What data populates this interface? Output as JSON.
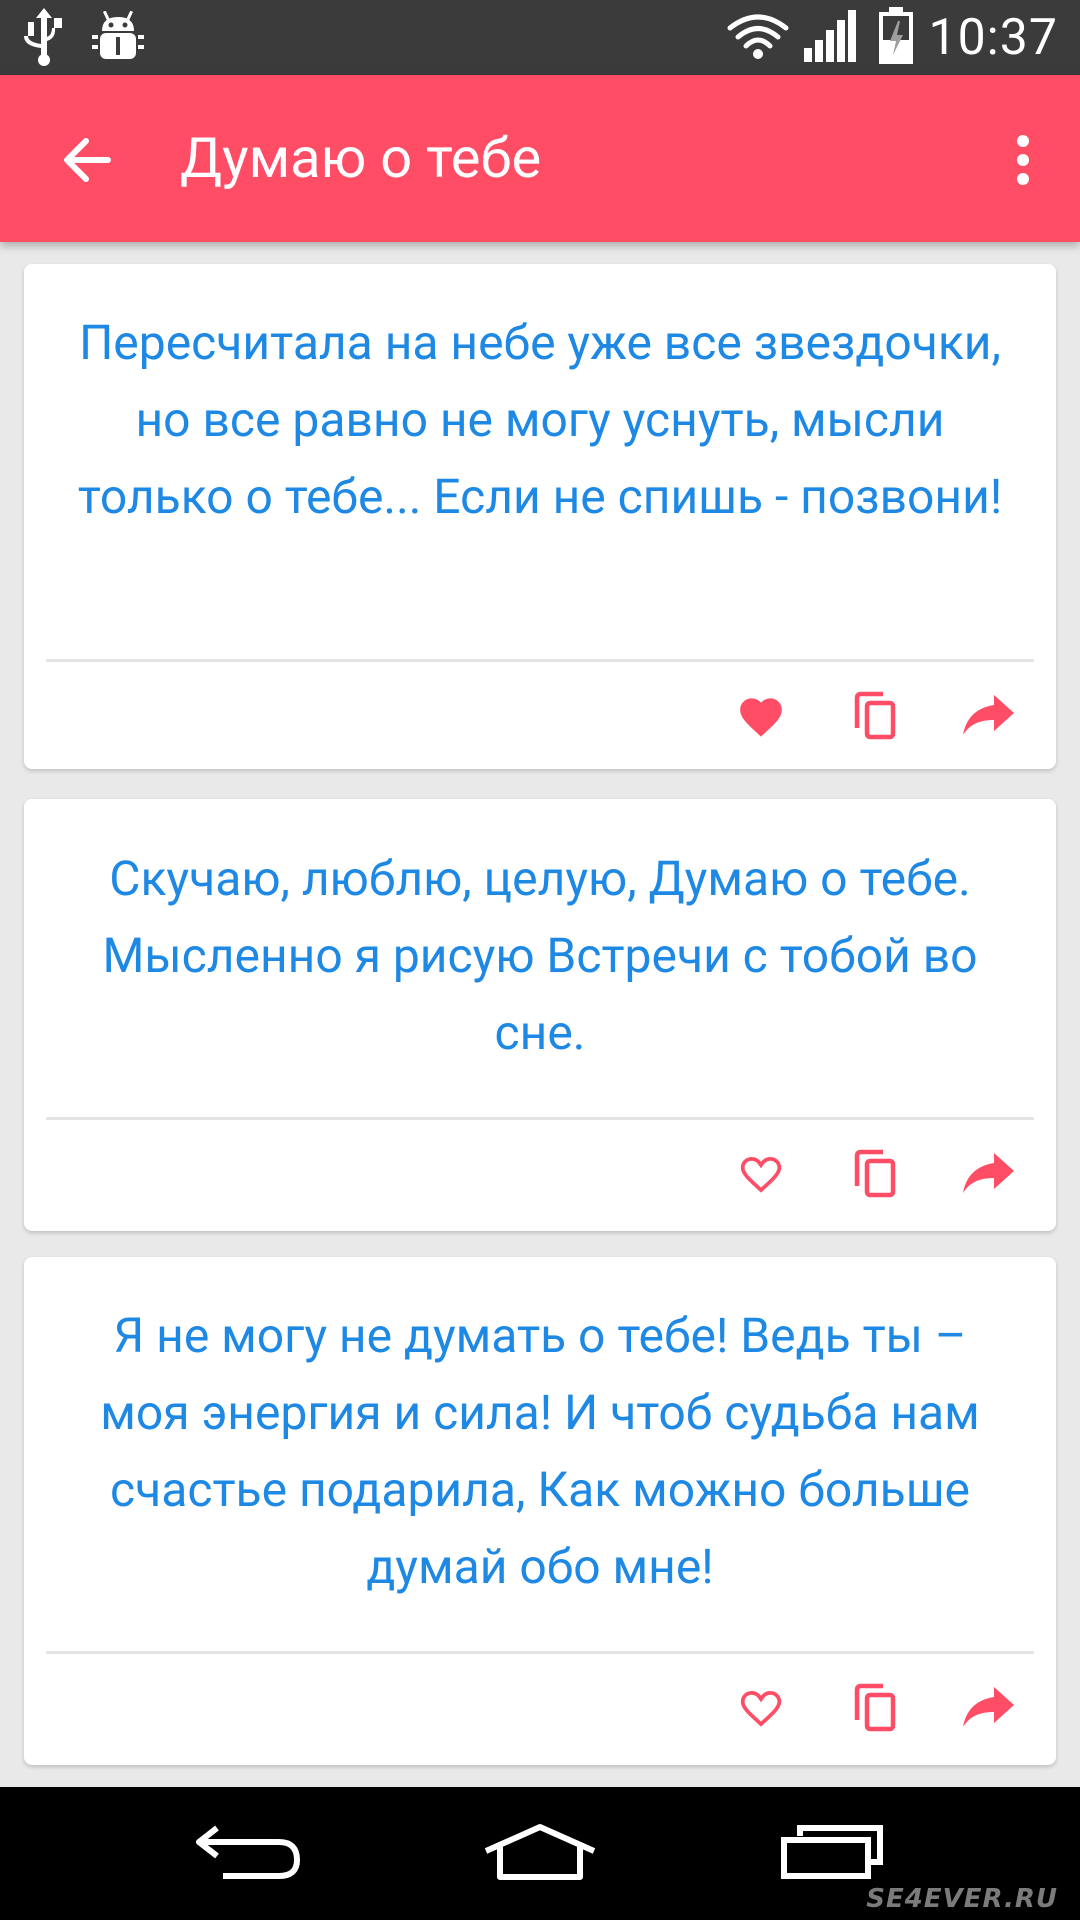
{
  "status_bar": {
    "time": "10:37",
    "icons": [
      "usb-icon",
      "android-debug-icon",
      "wifi-icon",
      "signal-icon",
      "battery-icon"
    ]
  },
  "app_bar": {
    "title": "Думаю о тебе",
    "background": "#ff4d66",
    "back_icon": "arrow-back-icon",
    "menu_icon": "more-vert-icon"
  },
  "cards": [
    {
      "text": "Пересчитала на небе уже все звездочки, но все равно не могу уснуть, мысли только о тебе... Если не спишь - позвони!",
      "favorited": true
    },
    {
      "text": "Скучаю, люблю, целую, Думаю о тебе. Мысленно я рисую Встречи с тобой во сне.",
      "favorited": false
    },
    {
      "text": "Я не могу не думать о тебе! Ведь ты – моя энергия и сила! И чтоб судьба нам счастье подарила, Как можно больше думай обо мне!",
      "favorited": false
    }
  ],
  "colors": {
    "accent": "#ff4d66",
    "quote_text": "#1e88e5"
  },
  "nav_bar": {
    "buttons": [
      "back-icon",
      "home-icon",
      "recents-icon"
    ]
  },
  "watermark": "SE4EVER.RU"
}
